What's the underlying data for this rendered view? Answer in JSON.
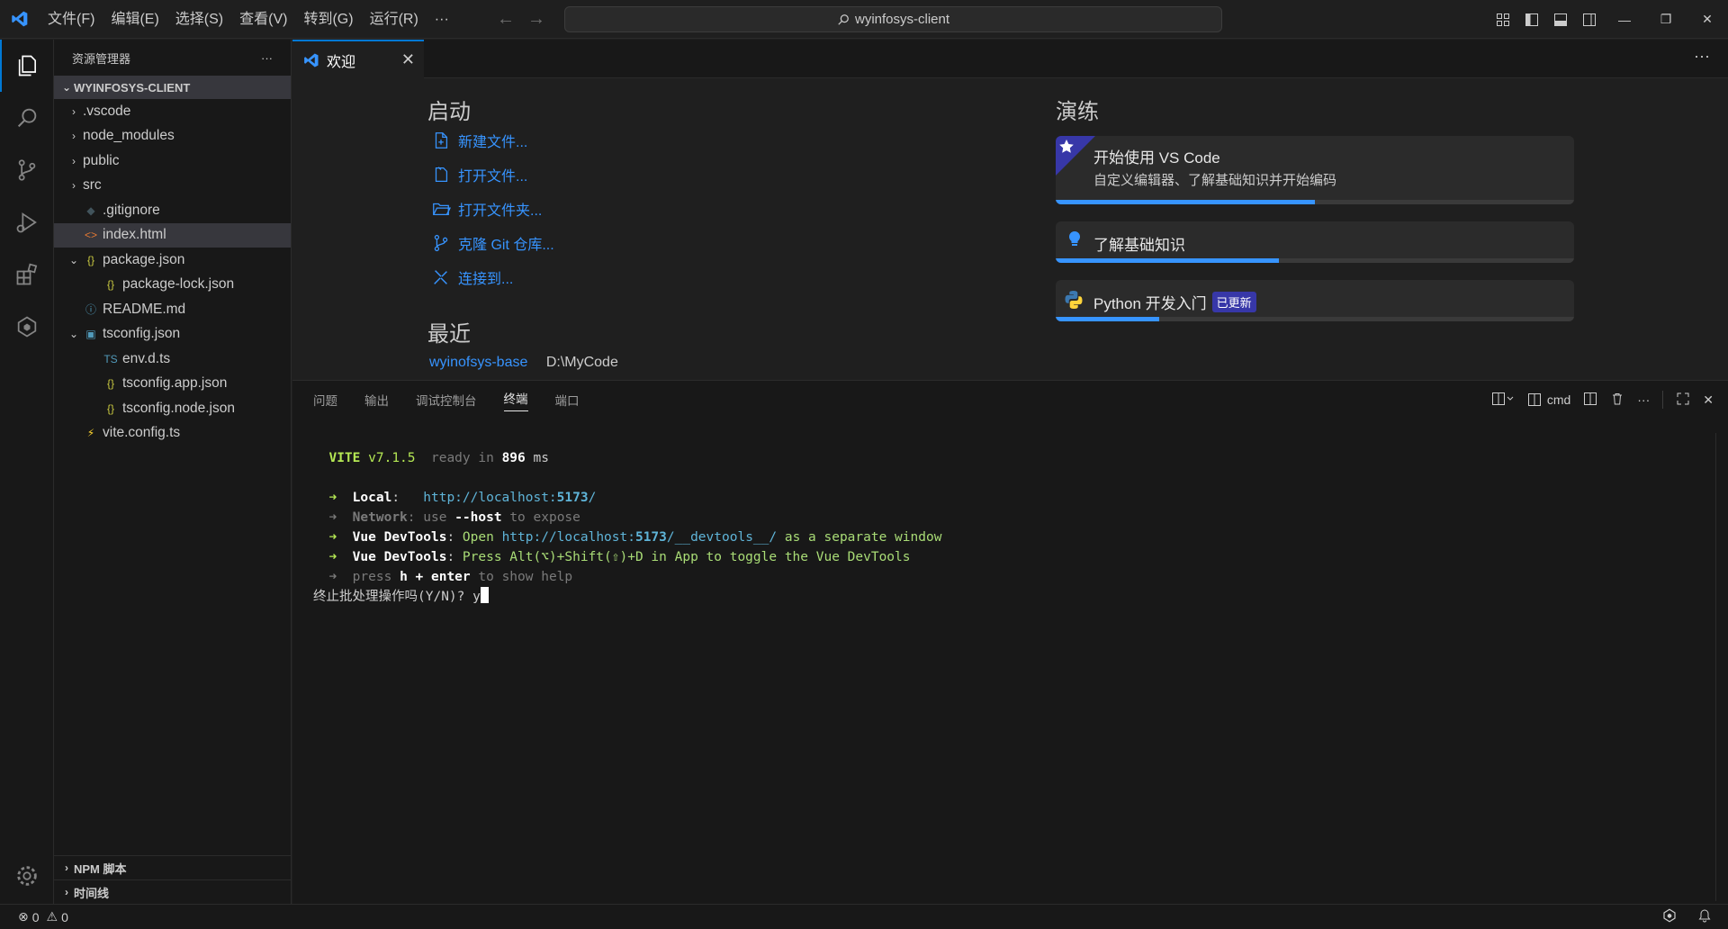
{
  "titlebar": {
    "menu": [
      "文件(F)",
      "编辑(E)",
      "选择(S)",
      "查看(V)",
      "转到(G)",
      "运行(R)",
      "···"
    ],
    "search_text": "wyinfosys-client"
  },
  "sidebar": {
    "title": "资源管理器",
    "more": "···",
    "folder": "WYINFOSYS-CLIENT",
    "items": [
      {
        "label": ".vscode",
        "chev": "›",
        "icon": "",
        "color": "#cccccc"
      },
      {
        "label": "node_modules",
        "chev": "›",
        "icon": "",
        "color": "#cccccc"
      },
      {
        "label": "public",
        "chev": "›",
        "icon": "",
        "color": "#cccccc"
      },
      {
        "label": "src",
        "chev": "›",
        "icon": "",
        "color": "#cccccc"
      },
      {
        "label": ".gitignore",
        "chev": "",
        "icon": "◆",
        "color": "#41535b"
      },
      {
        "label": "index.html",
        "chev": "",
        "icon": "<>",
        "color": "#e37933"
      },
      {
        "label": "package.json",
        "chev": "⌄",
        "icon": "{}",
        "color": "#cbcb41"
      },
      {
        "label": "package-lock.json",
        "chev": "",
        "icon": "{}",
        "color": "#cbcb41"
      },
      {
        "label": "README.md",
        "chev": "",
        "icon": "ⓘ",
        "color": "#519aba"
      },
      {
        "label": "tsconfig.json",
        "chev": "⌄",
        "icon": "▣",
        "color": "#519aba"
      },
      {
        "label": "env.d.ts",
        "chev": "",
        "icon": "TS",
        "color": "#519aba"
      },
      {
        "label": "tsconfig.app.json",
        "chev": "",
        "icon": "{}",
        "color": "#cbcb41"
      },
      {
        "label": "tsconfig.node.json",
        "chev": "",
        "icon": "{}",
        "color": "#cbcb41"
      },
      {
        "label": "vite.config.ts",
        "chev": "",
        "icon": "⚡",
        "color": "#ffd62e"
      }
    ],
    "sections": [
      "NPM 脚本",
      "时间线"
    ]
  },
  "tab": {
    "label": "欢迎",
    "close": "✕"
  },
  "welcome": {
    "start_title": "启动",
    "start_links": [
      "新建文件...",
      "打开文件...",
      "打开文件夹...",
      "克隆 Git 仓库...",
      "连接到..."
    ],
    "recent_title": "最近",
    "recent_name": "wyinofsys-base",
    "recent_path": "D:\\MyCode",
    "walk_title": "演练",
    "walkthroughs": [
      {
        "title": "开始使用 VS Code",
        "desc": "自定义编辑器、了解基础知识并开始编码",
        "progress": 0.5
      },
      {
        "title": "了解基础知识",
        "progress": 0.43
      },
      {
        "title": "Python 开发入门",
        "badge": "已更新",
        "progress": 0.2
      }
    ]
  },
  "panel": {
    "tabs": [
      "问题",
      "输出",
      "调试控制台",
      "终端",
      "端口"
    ],
    "active_tab": "终端",
    "shell": "cmd",
    "terminal": {
      "vite": "VITE",
      "version": "v7.1.5",
      "ready": "ready in",
      "ms": "896",
      "ms_unit": "ms",
      "local_label": "Local",
      "local_url_a": "http://localhost:",
      "local_port": "5173",
      "local_url_b": "/",
      "network_label": "Network",
      "network_use": "use",
      "network_flag": "--host",
      "network_to": "to expose",
      "dev_label": "Vue DevTools",
      "dev1_open": "Open",
      "dev1_url_a": "http://localhost:",
      "dev1_port": "5173",
      "dev1_url_b": "/__devtools__/",
      "dev1_rest": "as a separate window",
      "dev2_text": "Press Alt(⌥)+Shift(⇧)+D in App to toggle the Vue DevTools",
      "help_press": "press",
      "help_key": "h + enter",
      "help_rest": "to show help",
      "prompt": "终止批处理操作吗(Y/N)? y"
    }
  },
  "status": {
    "errors": "0",
    "warnings": "0"
  }
}
